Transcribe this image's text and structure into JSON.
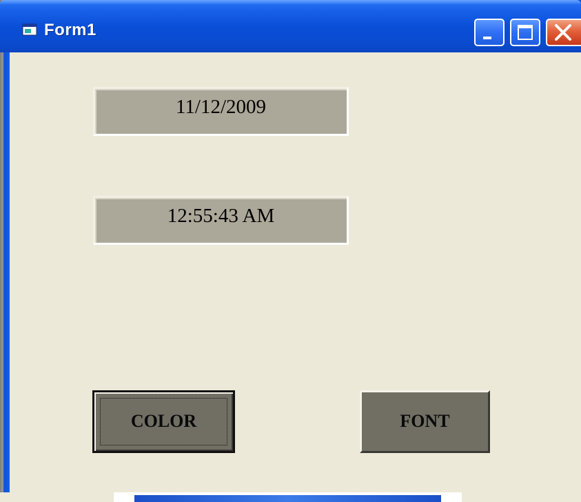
{
  "window": {
    "title": "Form1",
    "icon": "vb-form-icon",
    "controls": {
      "minimize": "minimize-icon",
      "maximize": "maximize-icon",
      "close": "close-icon"
    },
    "colors": {
      "titlebar": "#0a4fd8",
      "client": "#ece9d8",
      "label_background": "#aca899",
      "button_background": "#716f64"
    }
  },
  "form": {
    "date_label": "11/12/2009",
    "time_label": "12:55:43 AM",
    "color_button": "COLOR",
    "font_button": "FONT"
  }
}
